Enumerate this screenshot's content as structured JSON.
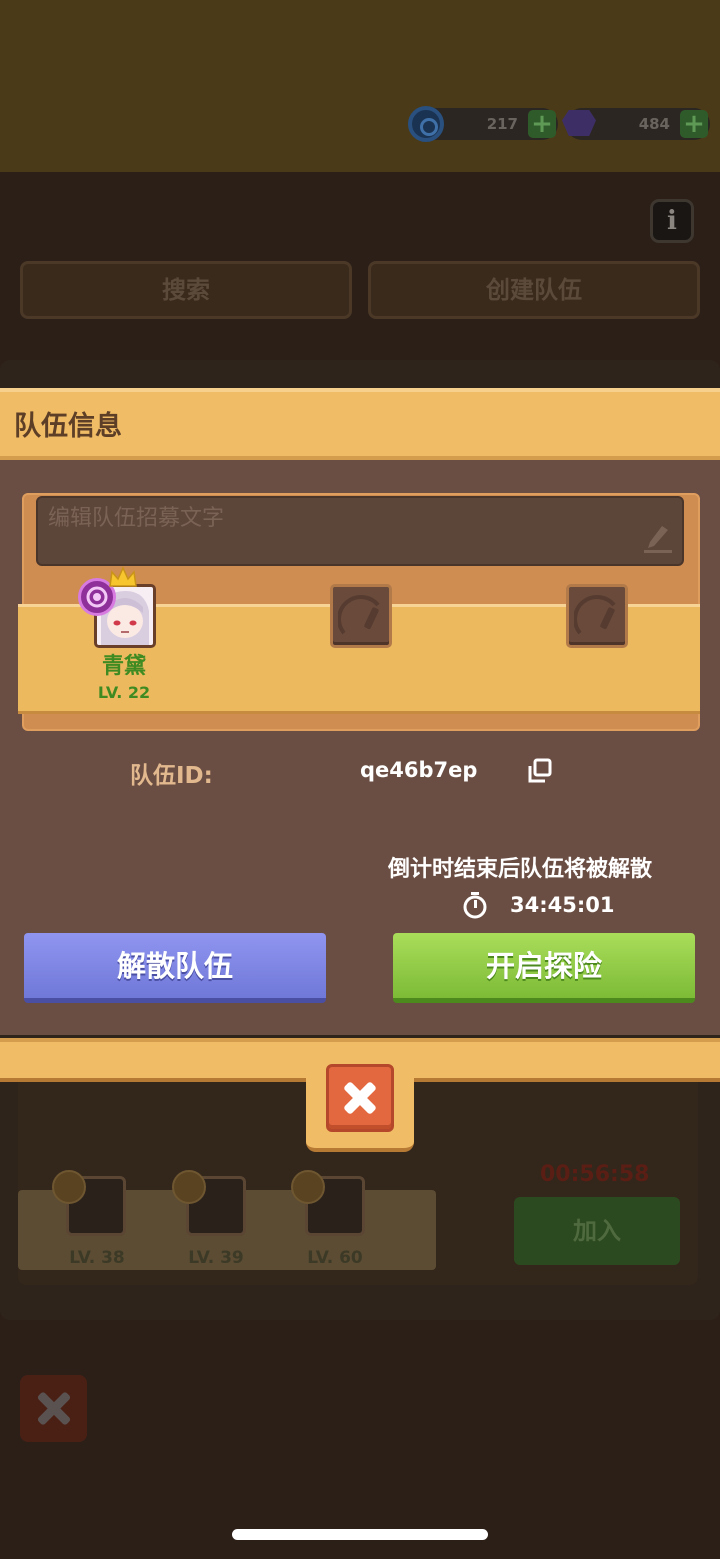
{
  "currencies": [
    {
      "icon": "coin-icon",
      "value": "217"
    },
    {
      "icon": "gem-icon",
      "value": "484"
    }
  ],
  "background": {
    "tabs": [
      "搜索",
      "创建队伍"
    ],
    "list_levels": [
      "LV. 38",
      "LV. 39",
      "LV. 60"
    ],
    "list_timer": "00:56:58",
    "join_label": "加入"
  },
  "modal": {
    "title": "队伍信息",
    "recruit_placeholder": "编辑队伍招募文字",
    "member": {
      "name": "青黛",
      "level": "LV. 22"
    },
    "team_id_label": "队伍ID:",
    "team_id": "qe46b7ep",
    "disband_note": "倒计时结束后队伍将被解散",
    "countdown": "34:45:01",
    "disband_button": "解散队伍",
    "start_button": "开启探险"
  },
  "colors": {
    "header": "#f0bc65",
    "body": "#6b4e43",
    "disband": "#7c83e2",
    "start": "#92cc45",
    "close": "#e4683f",
    "member_text": "#3f8b22"
  }
}
